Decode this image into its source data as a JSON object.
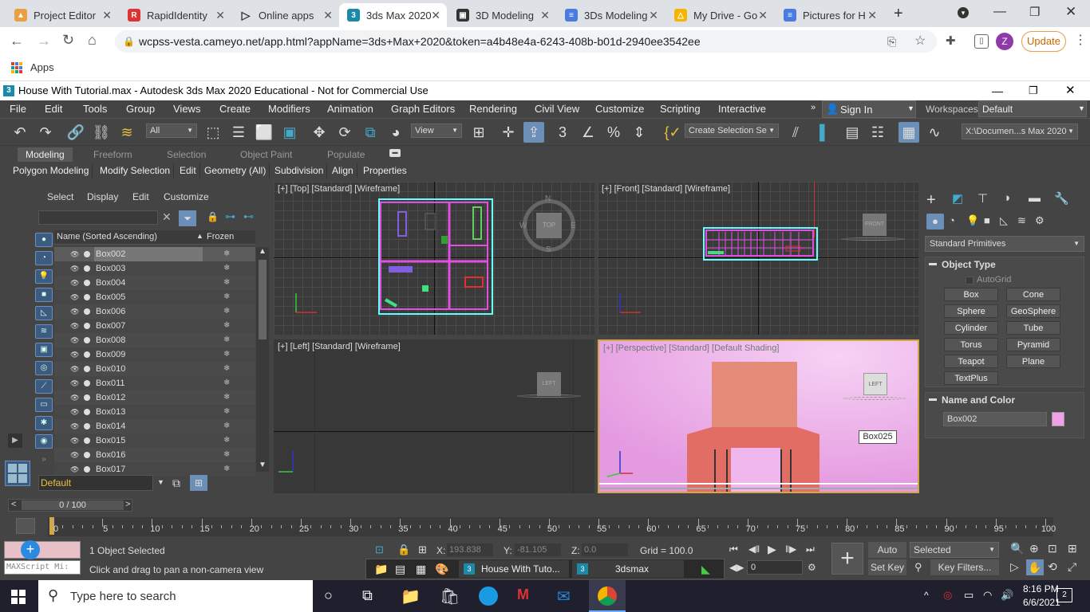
{
  "browser": {
    "tabs": [
      {
        "label": "Project Editor",
        "fav_color": "#e8a040"
      },
      {
        "label": "RapidIdentity",
        "fav_color": "#d33"
      },
      {
        "label": "Online apps",
        "fav_color": "#333"
      },
      {
        "label": "3ds Max 2020",
        "fav_color": "#1a8aa8"
      },
      {
        "label": "3D Modeling",
        "fav_color": "#333"
      },
      {
        "label": "3Ds Modeling",
        "fav_color": "#4a7be0"
      },
      {
        "label": "My Drive - Go",
        "fav_color": "#f4b400"
      },
      {
        "label": "Pictures for H",
        "fav_color": "#4a7be0"
      }
    ],
    "url": "wcpss-vesta.cameyo.net/app.html?appName=3ds+Max+2020&token=a4b48e4a-6243-408b-b01d-2940ee3542ee",
    "update_label": "Update",
    "profile_initial": "Z",
    "bookmarks_label": "Apps"
  },
  "app": {
    "title": "House With Tutorial.max - Autodesk 3ds Max 2020 Educational - Not for Commercial Use",
    "menu": [
      "File",
      "Edit",
      "Tools",
      "Group",
      "Views",
      "Create",
      "Modifiers",
      "Animation",
      "Graph Editors",
      "Rendering",
      "Civil View",
      "Customize",
      "Scripting",
      "Interactive"
    ],
    "sign_in": "Sign In",
    "workspaces_label": "Workspaces:",
    "workspaces_value": "Default",
    "toolbar": {
      "filter_value": "All",
      "refcoord_value": "View",
      "named_selection": "Create Selection Se",
      "project_path": "X:\\Documen...s Max 2020"
    },
    "ribbon_tabs": [
      "Modeling",
      "Freeform",
      "Selection",
      "Object Paint",
      "Populate"
    ],
    "ribbon_sub": [
      "Polygon Modeling",
      "Modify Selection",
      "Edit",
      "Geometry (All)",
      "Subdivision",
      "Align",
      "Properties"
    ]
  },
  "explorer": {
    "menu": [
      "Select",
      "Display",
      "Edit",
      "Customize"
    ],
    "col_name": "Name (Sorted Ascending)",
    "col_frozen": "Frozen",
    "rows": [
      "Box002",
      "Box003",
      "Box004",
      "Box005",
      "Box006",
      "Box007",
      "Box008",
      "Box009",
      "Box010",
      "Box011",
      "Box012",
      "Box013",
      "Box014",
      "Box015",
      "Box016",
      "Box017"
    ],
    "layer": "Default"
  },
  "viewports": {
    "top": "[+] [Top] [Standard] [Wireframe]",
    "front": "[+] [Front] [Standard] [Wireframe]",
    "left": "[+] [Left] [Standard] [Wireframe]",
    "perspective": "[+] [Perspective] [Standard] [Default Shading]",
    "tooltip": "Box025",
    "viewcube_top": "TOP",
    "viewcube_front": "FRONT",
    "viewcube_left": "LEFT",
    "compass_n": "N",
    "compass_s": "S",
    "compass_e": "E",
    "compass_w": "W"
  },
  "command": {
    "category": "Standard Primitives",
    "object_type": "Object Type",
    "autogrid": "AutoGrid",
    "buttons": [
      "Box",
      "Cone",
      "Sphere",
      "GeoSphere",
      "Cylinder",
      "Tube",
      "Torus",
      "Pyramid",
      "Teapot",
      "Plane",
      "TextPlus"
    ],
    "name_color": "Name and Color",
    "name_value": "Box002",
    "swatch": "#f0a0e8"
  },
  "time": {
    "slider": "0 / 100",
    "ticks": [
      "0",
      "5",
      "10",
      "15",
      "20",
      "25",
      "30",
      "35",
      "40",
      "45",
      "50",
      "55",
      "60",
      "65",
      "70",
      "75",
      "80",
      "85",
      "90",
      "95",
      "100"
    ]
  },
  "status": {
    "selected": "1 Object Selected",
    "prompt": "Click and drag to pan a non-camera view",
    "maxscript": "MAXScript Mi:",
    "x_label": "X:",
    "x": "193.838",
    "y_label": "Y:",
    "y": "-81.105",
    "z_label": "Z:",
    "z": "0.0",
    "grid": "Grid = 100.0",
    "autokey": "Auto Key",
    "setkey": "Set Key",
    "selected_dd": "Selected",
    "keyfilters": "Key Filters...",
    "frame": "0",
    "add_time_tag": "Add Time Tag",
    "task_window1": "House With Tuto...",
    "task_window2": "3dsmax"
  },
  "taskbar": {
    "search_placeholder": "Type here to search",
    "time": "8:16 PM",
    "date": "6/6/2021",
    "notif": "2"
  }
}
